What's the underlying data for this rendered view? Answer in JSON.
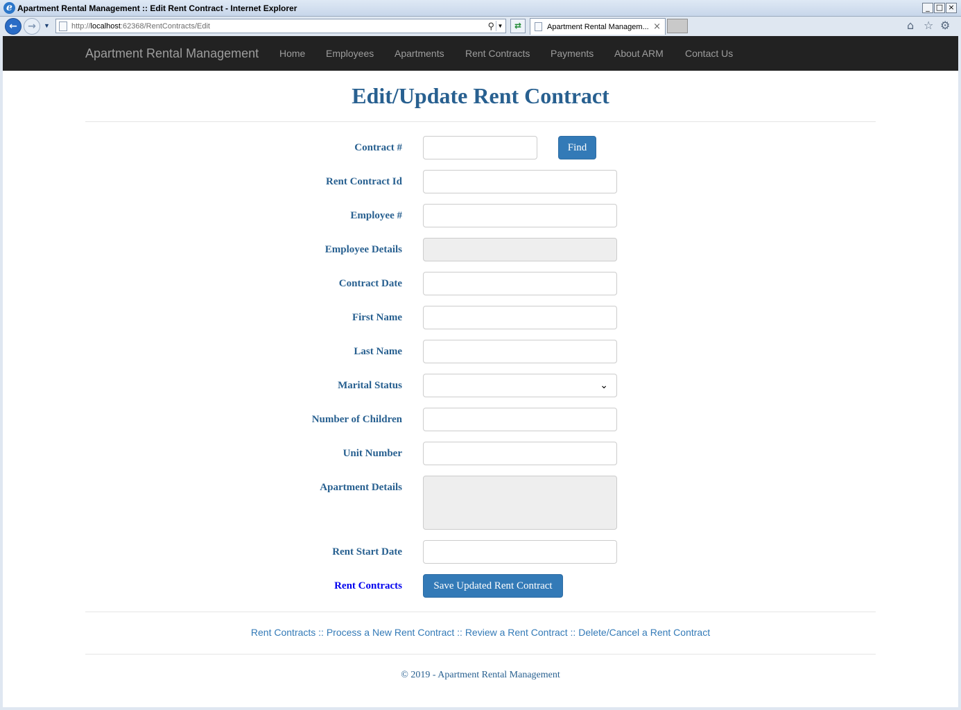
{
  "window": {
    "title": "Apartment Rental Management :: Edit Rent Contract - Internet Explorer",
    "ie_logo_glyph": "e",
    "minimize_glyph": "_",
    "maximize_glyph": "□",
    "close_glyph": "×"
  },
  "browser": {
    "back_glyph": "←",
    "forward_glyph": "→",
    "url_prefix": "http://",
    "url_host": "localhost",
    "url_rest": ":62368/RentContracts/Edit",
    "tab_label": "Apartment Rental Managem...",
    "tab_close_glyph": "×",
    "home_glyph": "⌂",
    "favorites_glyph": "☆",
    "tools_glyph": "⚙"
  },
  "site_nav": {
    "brand": "Apartment Rental Management",
    "links": [
      "Home",
      "Employees",
      "Apartments",
      "Rent Contracts",
      "Payments",
      "About ARM",
      "Contact Us"
    ]
  },
  "page": {
    "title": "Edit/Update Rent Contract"
  },
  "form": {
    "contract_number_label": "Contract #",
    "contract_number_value": "",
    "find_button": "Find",
    "rent_contract_id_label": "Rent Contract Id",
    "rent_contract_id_value": "",
    "employee_number_label": "Employee #",
    "employee_number_value": "",
    "employee_details_label": "Employee Details",
    "employee_details_value": "",
    "contract_date_label": "Contract Date",
    "contract_date_value": "",
    "first_name_label": "First Name",
    "first_name_value": "",
    "last_name_label": "Last Name",
    "last_name_value": "",
    "marital_status_label": "Marital Status",
    "marital_status_value": "",
    "number_of_children_label": "Number of Children",
    "number_of_children_value": "",
    "unit_number_label": "Unit Number",
    "unit_number_value": "",
    "apartment_details_label": "Apartment Details",
    "apartment_details_value": "",
    "rent_start_date_label": "Rent Start Date",
    "rent_start_date_value": "",
    "rent_contracts_link": "Rent Contracts",
    "save_button": "Save Updated Rent Contract"
  },
  "footer": {
    "links": [
      "Rent Contracts",
      "Process a New Rent Contract",
      "Review a Rent Contract",
      "Delete/Cancel a Rent Contract"
    ],
    "separator": "::",
    "copyright": "© 2019 - Apartment Rental Management"
  },
  "colors": {
    "accent": "#286090",
    "button": "#337ab7",
    "navbar": "#222222"
  }
}
